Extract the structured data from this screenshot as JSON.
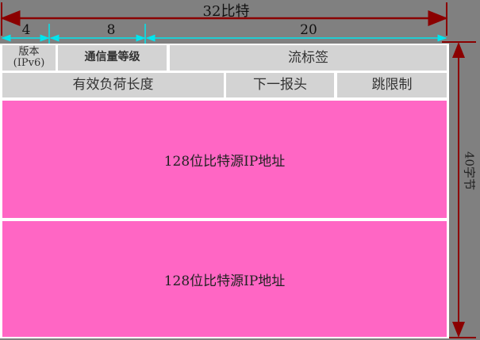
{
  "total_width_label": "32比特",
  "field_bits": [
    "4",
    "8",
    "20"
  ],
  "row1": {
    "version": "版本",
    "version_sub": "(IPv6)",
    "traffic_class": "通信量等级",
    "flow_label": "流标签"
  },
  "row2": {
    "payload_length": "有效负荷长度",
    "next_header": "下一报头",
    "hop_limit": "跳限制"
  },
  "source_address": "128位比特源IP地址",
  "dest_address": "128位比特源IP地址",
  "total_height_label": "40字节",
  "colors": {
    "background": "#808080",
    "field": "#d3d3d3",
    "address": "#ff66c4",
    "arrow": "#8b0000",
    "dimension": "#00e5ee"
  }
}
